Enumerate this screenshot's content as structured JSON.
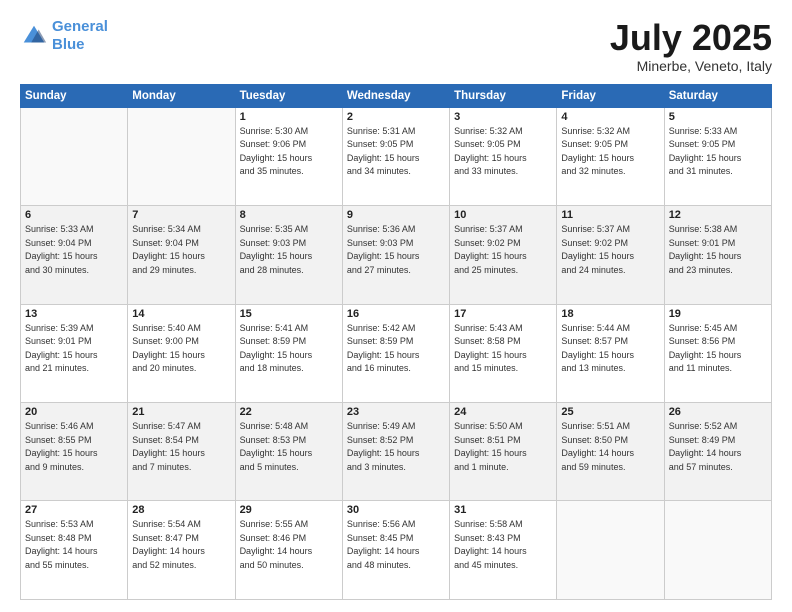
{
  "logo": {
    "line1": "General",
    "line2": "Blue"
  },
  "title": "July 2025",
  "location": "Minerbe, Veneto, Italy",
  "days_of_week": [
    "Sunday",
    "Monday",
    "Tuesday",
    "Wednesday",
    "Thursday",
    "Friday",
    "Saturday"
  ],
  "weeks": [
    [
      {
        "day": "",
        "info": ""
      },
      {
        "day": "",
        "info": ""
      },
      {
        "day": "1",
        "info": "Sunrise: 5:30 AM\nSunset: 9:06 PM\nDaylight: 15 hours\nand 35 minutes."
      },
      {
        "day": "2",
        "info": "Sunrise: 5:31 AM\nSunset: 9:05 PM\nDaylight: 15 hours\nand 34 minutes."
      },
      {
        "day": "3",
        "info": "Sunrise: 5:32 AM\nSunset: 9:05 PM\nDaylight: 15 hours\nand 33 minutes."
      },
      {
        "day": "4",
        "info": "Sunrise: 5:32 AM\nSunset: 9:05 PM\nDaylight: 15 hours\nand 32 minutes."
      },
      {
        "day": "5",
        "info": "Sunrise: 5:33 AM\nSunset: 9:05 PM\nDaylight: 15 hours\nand 31 minutes."
      }
    ],
    [
      {
        "day": "6",
        "info": "Sunrise: 5:33 AM\nSunset: 9:04 PM\nDaylight: 15 hours\nand 30 minutes."
      },
      {
        "day": "7",
        "info": "Sunrise: 5:34 AM\nSunset: 9:04 PM\nDaylight: 15 hours\nand 29 minutes."
      },
      {
        "day": "8",
        "info": "Sunrise: 5:35 AM\nSunset: 9:03 PM\nDaylight: 15 hours\nand 28 minutes."
      },
      {
        "day": "9",
        "info": "Sunrise: 5:36 AM\nSunset: 9:03 PM\nDaylight: 15 hours\nand 27 minutes."
      },
      {
        "day": "10",
        "info": "Sunrise: 5:37 AM\nSunset: 9:02 PM\nDaylight: 15 hours\nand 25 minutes."
      },
      {
        "day": "11",
        "info": "Sunrise: 5:37 AM\nSunset: 9:02 PM\nDaylight: 15 hours\nand 24 minutes."
      },
      {
        "day": "12",
        "info": "Sunrise: 5:38 AM\nSunset: 9:01 PM\nDaylight: 15 hours\nand 23 minutes."
      }
    ],
    [
      {
        "day": "13",
        "info": "Sunrise: 5:39 AM\nSunset: 9:01 PM\nDaylight: 15 hours\nand 21 minutes."
      },
      {
        "day": "14",
        "info": "Sunrise: 5:40 AM\nSunset: 9:00 PM\nDaylight: 15 hours\nand 20 minutes."
      },
      {
        "day": "15",
        "info": "Sunrise: 5:41 AM\nSunset: 8:59 PM\nDaylight: 15 hours\nand 18 minutes."
      },
      {
        "day": "16",
        "info": "Sunrise: 5:42 AM\nSunset: 8:59 PM\nDaylight: 15 hours\nand 16 minutes."
      },
      {
        "day": "17",
        "info": "Sunrise: 5:43 AM\nSunset: 8:58 PM\nDaylight: 15 hours\nand 15 minutes."
      },
      {
        "day": "18",
        "info": "Sunrise: 5:44 AM\nSunset: 8:57 PM\nDaylight: 15 hours\nand 13 minutes."
      },
      {
        "day": "19",
        "info": "Sunrise: 5:45 AM\nSunset: 8:56 PM\nDaylight: 15 hours\nand 11 minutes."
      }
    ],
    [
      {
        "day": "20",
        "info": "Sunrise: 5:46 AM\nSunset: 8:55 PM\nDaylight: 15 hours\nand 9 minutes."
      },
      {
        "day": "21",
        "info": "Sunrise: 5:47 AM\nSunset: 8:54 PM\nDaylight: 15 hours\nand 7 minutes."
      },
      {
        "day": "22",
        "info": "Sunrise: 5:48 AM\nSunset: 8:53 PM\nDaylight: 15 hours\nand 5 minutes."
      },
      {
        "day": "23",
        "info": "Sunrise: 5:49 AM\nSunset: 8:52 PM\nDaylight: 15 hours\nand 3 minutes."
      },
      {
        "day": "24",
        "info": "Sunrise: 5:50 AM\nSunset: 8:51 PM\nDaylight: 15 hours\nand 1 minute."
      },
      {
        "day": "25",
        "info": "Sunrise: 5:51 AM\nSunset: 8:50 PM\nDaylight: 14 hours\nand 59 minutes."
      },
      {
        "day": "26",
        "info": "Sunrise: 5:52 AM\nSunset: 8:49 PM\nDaylight: 14 hours\nand 57 minutes."
      }
    ],
    [
      {
        "day": "27",
        "info": "Sunrise: 5:53 AM\nSunset: 8:48 PM\nDaylight: 14 hours\nand 55 minutes."
      },
      {
        "day": "28",
        "info": "Sunrise: 5:54 AM\nSunset: 8:47 PM\nDaylight: 14 hours\nand 52 minutes."
      },
      {
        "day": "29",
        "info": "Sunrise: 5:55 AM\nSunset: 8:46 PM\nDaylight: 14 hours\nand 50 minutes."
      },
      {
        "day": "30",
        "info": "Sunrise: 5:56 AM\nSunset: 8:45 PM\nDaylight: 14 hours\nand 48 minutes."
      },
      {
        "day": "31",
        "info": "Sunrise: 5:58 AM\nSunset: 8:43 PM\nDaylight: 14 hours\nand 45 minutes."
      },
      {
        "day": "",
        "info": ""
      },
      {
        "day": "",
        "info": ""
      }
    ]
  ]
}
